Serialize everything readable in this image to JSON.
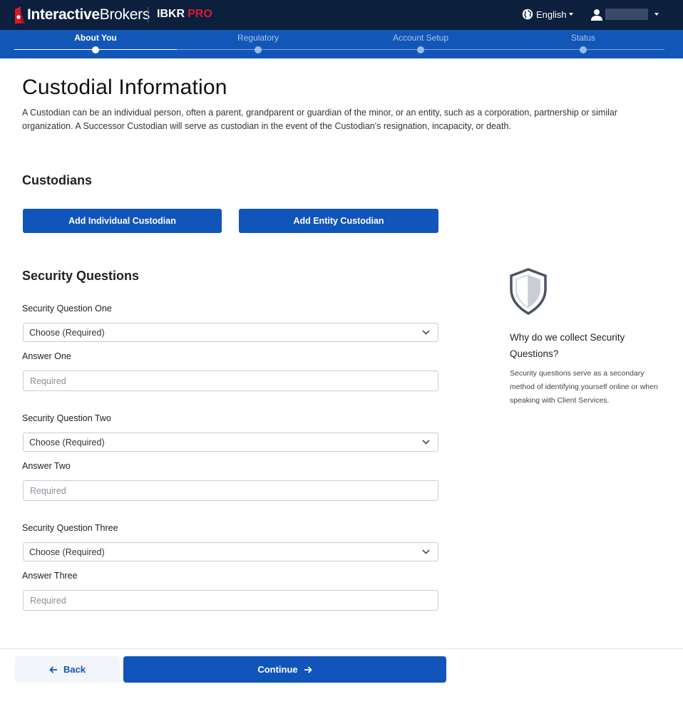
{
  "header": {
    "brand_bold": "Interactive",
    "brand_regular": "Brokers",
    "product": "IBKR",
    "product_tier": "PRO",
    "language": "English",
    "colors": {
      "background": "#0c1f3d",
      "pro_red": "#d81b2c"
    }
  },
  "stepper": {
    "steps": [
      {
        "label": "About You",
        "state": "active"
      },
      {
        "label": "Regulatory",
        "state": "upcoming"
      },
      {
        "label": "Account Setup",
        "state": "upcoming"
      },
      {
        "label": "Status",
        "state": "upcoming"
      }
    ]
  },
  "page": {
    "title": "Custodial Information",
    "description": "A Custodian can be an individual person, often a parent, grandparent or guardian of the minor, or an entity, such as a corporation, partnership or similar organization. A Successor Custodian will serve as custodian in the event of the Custodian's resignation, incapacity, or death."
  },
  "custodians": {
    "title": "Custodians",
    "add_individual_label": "Add Individual Custodian",
    "add_entity_label": "Add Entity Custodian"
  },
  "security": {
    "title": "Security Questions",
    "questions": [
      {
        "question_label": "Security Question One",
        "select_value": "Choose (Required)",
        "answer_label": "Answer One",
        "answer_placeholder": "Required"
      },
      {
        "question_label": "Security Question Two",
        "select_value": "Choose (Required)",
        "answer_label": "Answer Two",
        "answer_placeholder": "Required"
      },
      {
        "question_label": "Security Question Three",
        "select_value": "Choose (Required)",
        "answer_label": "Answer Three",
        "answer_placeholder": "Required"
      }
    ]
  },
  "info": {
    "icon": "shield-icon",
    "title": "Why do we collect Security Questions?",
    "text": "Security questions serve as a secondary method of identifying yourself online or when speaking with Client Services."
  },
  "footer": {
    "back_label": "Back",
    "continue_label": "Continue",
    "colors": {
      "primary": "#1155bb"
    }
  }
}
